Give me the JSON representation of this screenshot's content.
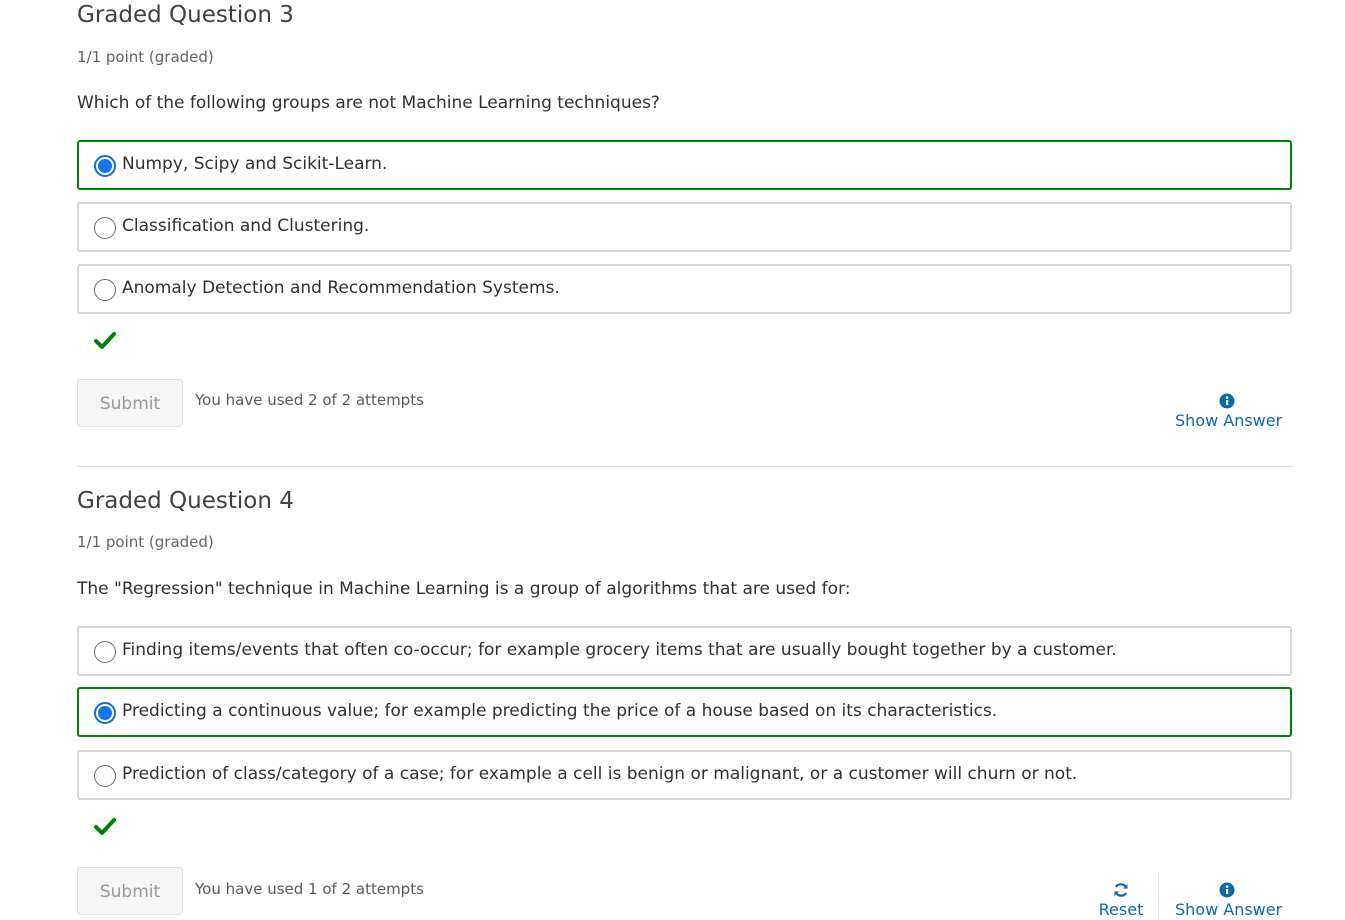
{
  "questions": [
    {
      "title": "Graded Question 3",
      "points": "1/1 point (graded)",
      "text": "Which of the following groups are not Machine Learning techniques?",
      "choices": [
        {
          "label": "Numpy, Scipy and Scikit-Learn.",
          "selected": true,
          "correct": true
        },
        {
          "label": "Classification and Clustering.",
          "selected": false,
          "correct": false
        },
        {
          "label": "Anomaly Detection and Recommendation Systems.",
          "selected": false,
          "correct": false
        }
      ],
      "status_icon": "checkmark-icon",
      "submit_label": "Submit",
      "attempts": "You have used 2 of 2 attempts",
      "show_answer_label": "Show Answer"
    },
    {
      "title": "Graded Question 4",
      "points": "1/1 point (graded)",
      "text": "The \"Regression\" technique in Machine Learning is a group of algorithms that are used for:",
      "choices": [
        {
          "label": "Finding items/events that often co-occur; for example grocery items that are usually bought together by a customer.",
          "selected": false,
          "correct": false
        },
        {
          "label": "Predicting a continuous value; for example predicting the price of a house based on its characteristics.",
          "selected": true,
          "correct": true
        },
        {
          "label": "Prediction of class/category of a case; for example a cell is benign or malignant, or a customer will churn or not.",
          "selected": false,
          "correct": false
        }
      ],
      "status_icon": "checkmark-icon",
      "submit_label": "Submit",
      "attempts": "You have used 1 of 2 attempts",
      "reset_label": "Reset",
      "show_answer_label": "Show Answer"
    }
  ],
  "colors": {
    "correct_border": "#008100",
    "radio_selected": "#1a73e8",
    "link": "#0b6aa8"
  }
}
